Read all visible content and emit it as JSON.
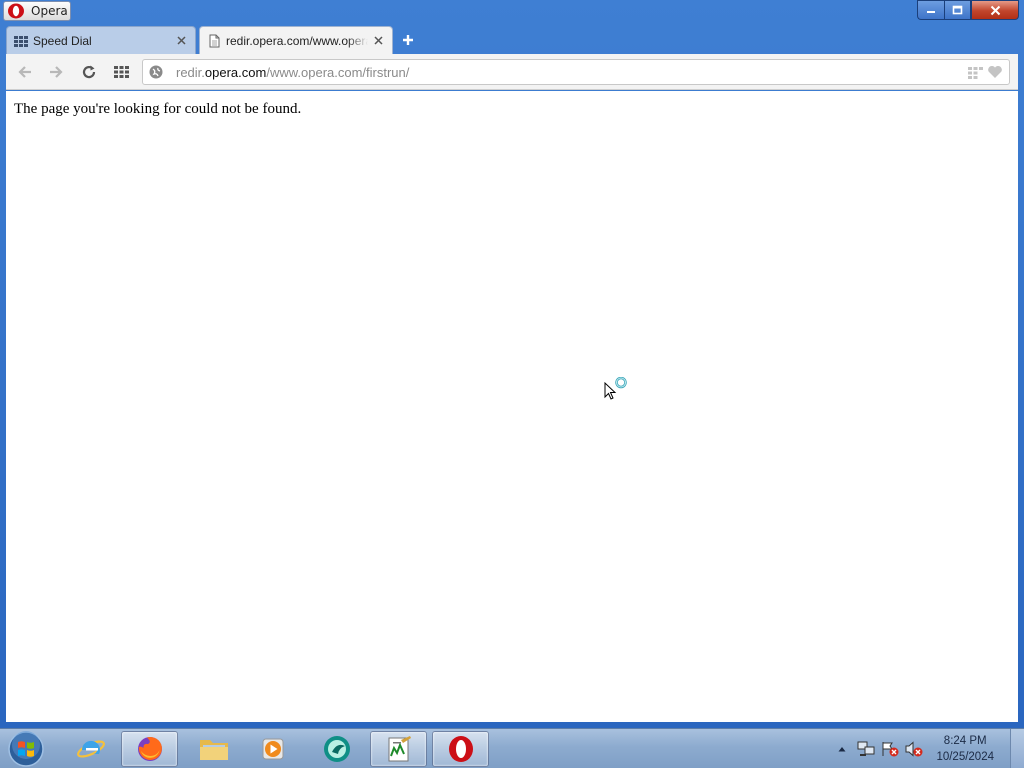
{
  "app": {
    "menu_label": "Opera"
  },
  "tabs": [
    {
      "title": "Speed Dial",
      "active": false,
      "icon": "speed-dial-icon"
    },
    {
      "title": "redir.opera.com/www.opera.com/firstrun/",
      "active": true,
      "icon": "page-icon"
    }
  ],
  "address_bar": {
    "url_prefix": "redir.",
    "url_domain": "opera.com",
    "url_path": "/www.opera.com/firstrun/"
  },
  "page": {
    "message": "The page you're looking for could not be found."
  },
  "taskbar": {
    "apps": [
      "start-orb",
      "internet-explorer",
      "firefox",
      "file-explorer",
      "media-player",
      "app-teal",
      "script-editor",
      "opera"
    ],
    "active_apps": [
      "firefox",
      "script-editor",
      "opera"
    ]
  },
  "clock": {
    "time": "8:24 PM",
    "date": "10/25/2024"
  },
  "colors": {
    "opera_red": "#cc0f16",
    "window_blue": "#2f6fc4",
    "address_domain": "#111111",
    "address_muted": "#8a8a8a"
  }
}
